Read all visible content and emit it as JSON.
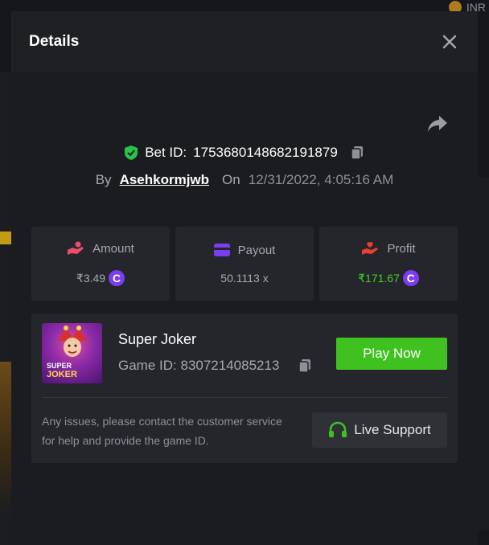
{
  "background": {
    "currency": "INR"
  },
  "modal": {
    "title": "Details",
    "bet_id_label": "Bet ID:",
    "bet_id": "1753680148682191879",
    "by_label": "By",
    "username": "Asehkormjwb",
    "on_label": "On",
    "date": "12/31/2022, 4:05:16 AM"
  },
  "stats": {
    "amount": {
      "label": "Amount",
      "value": "₹3.49",
      "icon": "hand-coin-icon",
      "color": "#ee4d6c"
    },
    "payout": {
      "label": "Payout",
      "value": "50.1113 x",
      "icon": "wallet-icon",
      "color": "#7b3df2"
    },
    "profit": {
      "label": "Profit",
      "value": "₹171.67",
      "icon": "hand-heart-icon",
      "color": "#e8402f",
      "value_color": "#3fd12a"
    },
    "currency_badge": "C"
  },
  "game": {
    "name": "Super Joker",
    "game_id_label": "Game ID:",
    "game_id": "8307214085213",
    "thumb_line1": "SUPER",
    "thumb_line2": "JOKER",
    "play_label": "Play Now",
    "issue_text": "Any issues, please contact the customer service for help and provide the game ID.",
    "support_label": "Live Support"
  }
}
